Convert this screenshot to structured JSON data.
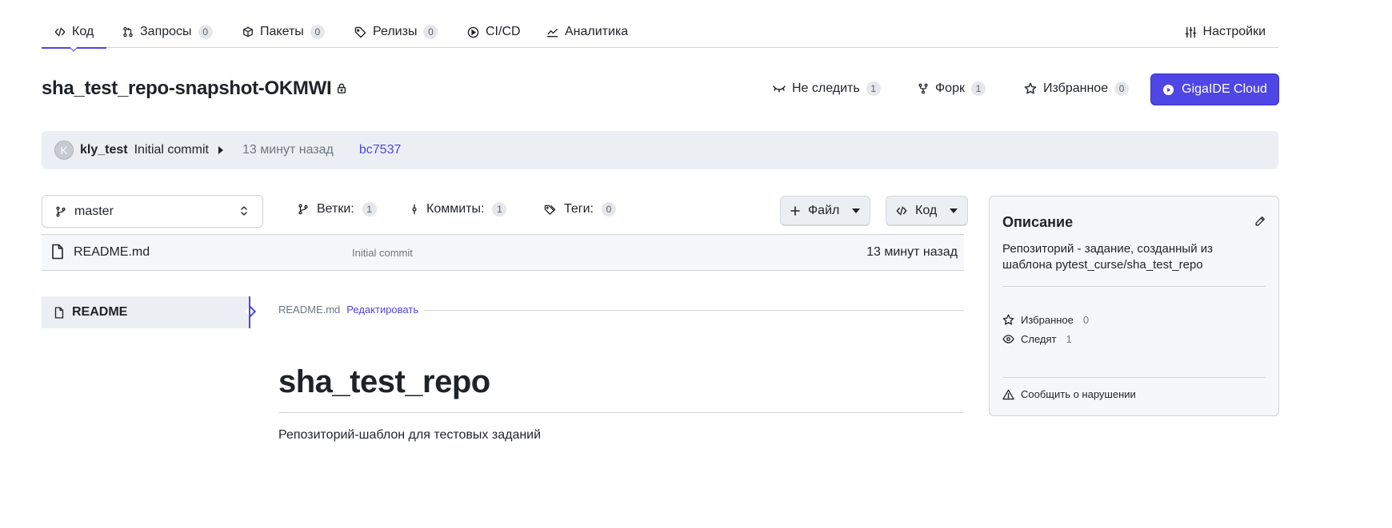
{
  "tabs": [
    {
      "label": "Код",
      "icon": "code-icon",
      "active": true
    },
    {
      "label": "Запросы",
      "icon": "pull-request-icon",
      "count": "0"
    },
    {
      "label": "Пакеты",
      "icon": "package-icon",
      "count": "0"
    },
    {
      "label": "Релизы",
      "icon": "tag-icon",
      "count": "0"
    },
    {
      "label": "CI/CD",
      "icon": "play-circle-icon"
    },
    {
      "label": "Аналитика",
      "icon": "graph-icon"
    }
  ],
  "settings_tab": {
    "label": "Настройки",
    "icon": "sliders-icon"
  },
  "repo": {
    "title": "sha_test_repo-snapshot-OKMWI",
    "private_icon": "lock-icon"
  },
  "actions": {
    "watch": {
      "label": "Не следить",
      "count": "1",
      "icon": "eye-closed-icon"
    },
    "fork": {
      "label": "Форк",
      "count": "1",
      "icon": "fork-icon"
    },
    "star": {
      "label": "Избранное",
      "count": "0",
      "icon": "star-icon"
    },
    "ide": {
      "label": "GigaIDE Cloud",
      "icon": "play-circle-icon"
    }
  },
  "commit": {
    "avatar_letter": "K",
    "author": "kly_test",
    "message": "Initial commit",
    "time": "13 минут назад",
    "hash": "bc7537"
  },
  "branch": {
    "current": "master",
    "branches_label": "Ветки:",
    "branches_count": "1",
    "commits_label": "Коммиты:",
    "commits_count": "1",
    "tags_label": "Теги:",
    "tags_count": "0",
    "file_button": "Файл",
    "code_button": "Код"
  },
  "files": [
    {
      "name": "README.md",
      "commit": "Initial commit",
      "time": "13 минут назад"
    }
  ],
  "readme": {
    "nav_label": "README",
    "file": "README.md",
    "edit": "Редактировать",
    "heading": "sha_test_repo",
    "body": "Репозиторий-шаблон для тестовых заданий"
  },
  "sidebar": {
    "title": "Описание",
    "description": "Репозиторий - задание, созданный из шаблона pytest_curse/sha_test_repo",
    "stars_label": "Избранное",
    "stars_count": "0",
    "watchers_label": "Следят",
    "watchers_count": "1",
    "report": "Сообщить о нарушении"
  },
  "colors": {
    "accent": "#4f46e5",
    "muted_bg": "#ebeef2",
    "border": "#d0d4d9"
  }
}
